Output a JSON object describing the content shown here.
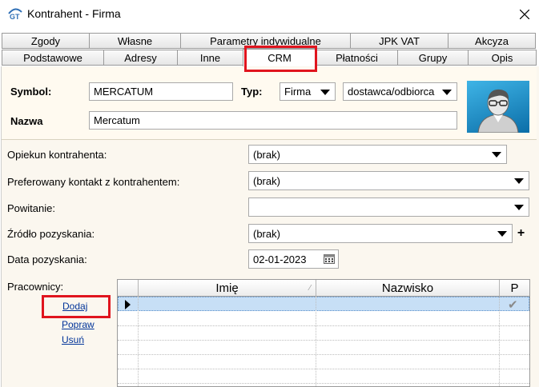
{
  "window": {
    "title": "Kontrahent - Firma",
    "app_icon_label": "GT"
  },
  "tabs_row1": [
    "Zgody",
    "Własne",
    "Parametry indywidualne",
    "JPK VAT",
    "Akcyza"
  ],
  "tabs_row2": [
    "Podstawowe",
    "Adresy",
    "Inne",
    "CRM",
    "Płatności",
    "Grupy",
    "Opis"
  ],
  "active_tab": "CRM",
  "header": {
    "symbol_label": "Symbol:",
    "symbol_value": "MERCATUM",
    "type_label": "Typ:",
    "type_value": "Firma",
    "role_value": "dostawca/odbiorca",
    "name_label": "Nazwa",
    "name_value": "Mercatum"
  },
  "crm": {
    "opiekun_label": "Opiekun kontrahenta:",
    "opiekun_value": "(brak)",
    "kontakt_label": "Preferowany kontakt z kontrahentem:",
    "kontakt_value": "(brak)",
    "powitanie_label": "Powitanie:",
    "powitanie_value": "",
    "zrodlo_label": "Źródło pozyskania:",
    "zrodlo_value": "(brak)",
    "zrodlo_add": "+",
    "data_label": "Data pozyskania:",
    "data_value": "02-01-2023"
  },
  "workers": {
    "label": "Pracownicy:",
    "add_link": "Dodaj",
    "edit_link": "Popraw",
    "delete_link": "Usuń",
    "columns": [
      "Imię",
      "Nazwisko",
      "P"
    ]
  },
  "colors": {
    "highlight": "#e0141e",
    "selected_row": "#c7dff6",
    "link": "#003399"
  }
}
